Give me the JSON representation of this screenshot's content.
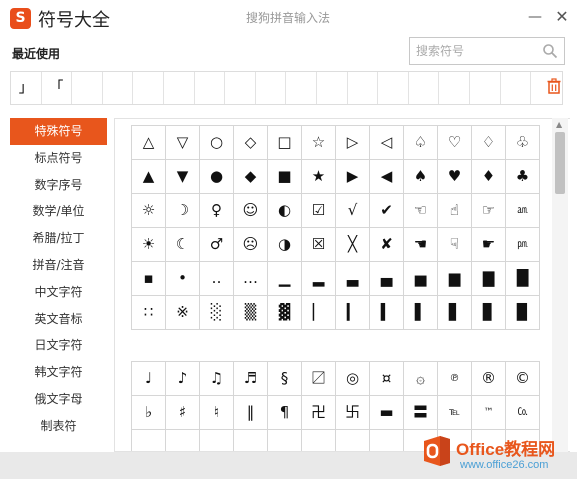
{
  "window": {
    "title": "符号大全",
    "ime_name": "搜狗拼音输入法",
    "logo_text": "S",
    "minimize_glyph": "—",
    "close_glyph": "✕"
  },
  "recent": {
    "label": "最近使用",
    "items": [
      "」",
      "「",
      "",
      "",
      "",
      "",
      "",
      "",
      "",
      "",
      "",
      "",
      "",
      "",
      "",
      "",
      "",
      ""
    ]
  },
  "search": {
    "placeholder": "搜索符号"
  },
  "categories": [
    {
      "label": "特殊符号",
      "active": true
    },
    {
      "label": "标点符号"
    },
    {
      "label": "数字序号"
    },
    {
      "label": "数学/单位"
    },
    {
      "label": "希腊/拉丁"
    },
    {
      "label": "拼音/注音"
    },
    {
      "label": "中文字符"
    },
    {
      "label": "英文音标"
    },
    {
      "label": "日文字符"
    },
    {
      "label": "韩文字符"
    },
    {
      "label": "俄文字母"
    },
    {
      "label": "制表符"
    }
  ],
  "symbols_group1": [
    "△",
    "▽",
    "○",
    "◇",
    "□",
    "☆",
    "▷",
    "◁",
    "♤",
    "♡",
    "♢",
    "♧",
    "▲",
    "▼",
    "●",
    "◆",
    "■",
    "★",
    "▶",
    "◀",
    "♠",
    "♥",
    "♦",
    "♣",
    "☼",
    "☽",
    "♀",
    "☺",
    "◐",
    "☑",
    "√",
    "✔",
    "☜",
    "☝",
    "☞",
    "㏂",
    "☀",
    "☾",
    "♂",
    "☹",
    "◑",
    "☒",
    "╳",
    "✘",
    "☚",
    "☟",
    "☛",
    "㏘",
    "▪",
    "•",
    "‥",
    "…",
    "▁",
    "▂",
    "▃",
    "▄",
    "▅",
    "▆",
    "▇",
    "█",
    "∷",
    "※",
    "░",
    "▒",
    "▓",
    "▏",
    "▎",
    "▍",
    "▌",
    "▋",
    "▊",
    "▉"
  ],
  "symbols_group2": [
    "♩",
    "♪",
    "♫",
    "♬",
    "§",
    "〼",
    "◎",
    "¤",
    "۞",
    "℗",
    "®",
    "©",
    "♭",
    "♯",
    "♮",
    "‖",
    "¶",
    "卍",
    "卐",
    "▬",
    "〓",
    "℡",
    "™",
    "㏇",
    "",
    "",
    "",
    "",
    "",
    "",
    "",
    "",
    "",
    "",
    "",
    ""
  ],
  "watermark": {
    "brand": "Office教程网",
    "url": "www.office26.com"
  },
  "colors": {
    "accent": "#e8561c",
    "logo": "#e94e1b",
    "grid_border": "#d6d6d6"
  }
}
